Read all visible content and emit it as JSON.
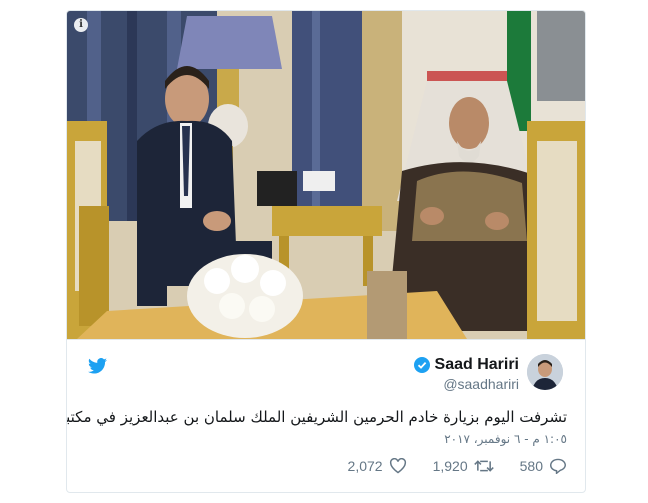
{
  "photo": {
    "info_icon": "i"
  },
  "tweet": {
    "author_name": "Saad Hariri",
    "author_handle": "@saadhariri",
    "text": "تشرفت اليوم بزيارة خادم الحرمين الشريفين الملك سلمان بن عبدالعزيز في مكتبه بقصر اليمامة",
    "timestamp": "١:٠٥ م - ٦ نوفمبر، ٢٠١٧",
    "likes": "2,072",
    "retweets": "1,920",
    "replies": "580"
  },
  "colors": {
    "twitter_blue": "#1da1f2",
    "verified_blue": "#1da1f2",
    "muted_text": "#657786"
  }
}
